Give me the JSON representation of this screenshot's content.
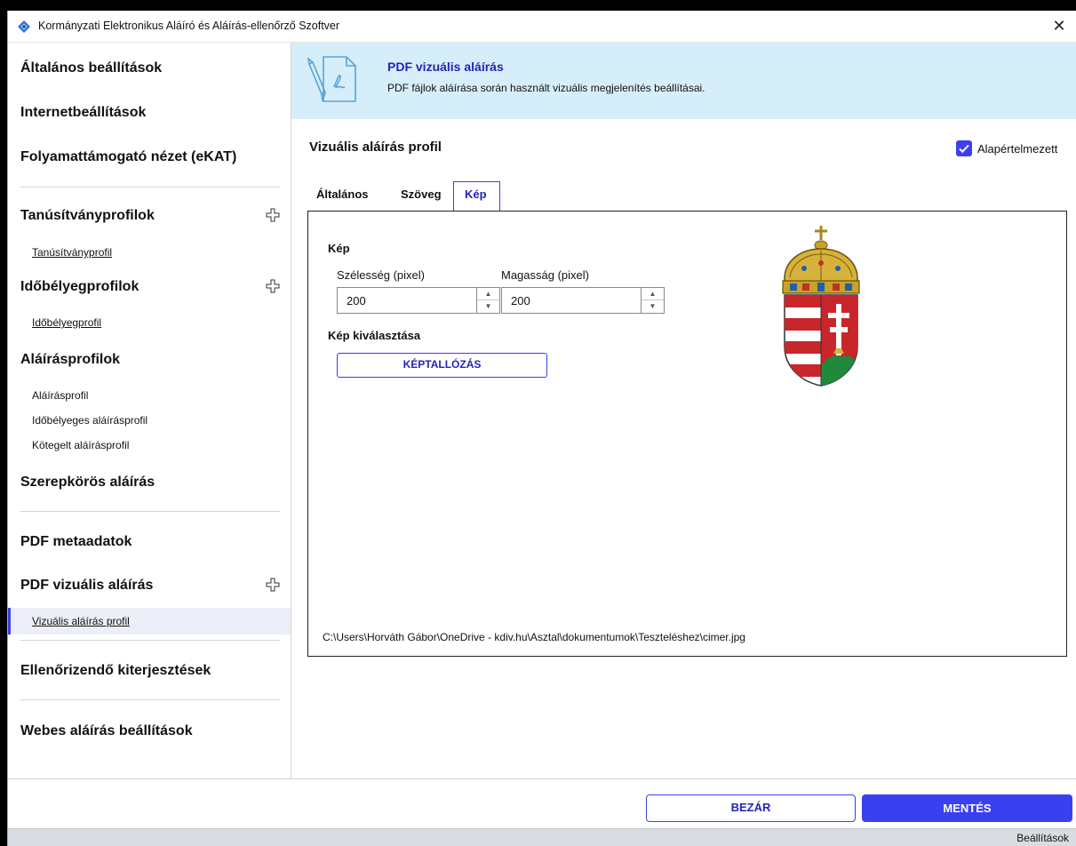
{
  "window": {
    "title": "Kormányzati Elektronikus Aláíró és Aláírás-ellenőrző Szoftver",
    "close_glyph": "✕"
  },
  "sidebar": {
    "general": "Általános beállítások",
    "internet": "Internetbeállítások",
    "ekat": "Folyamattámogató nézet (eKAT)",
    "cert_profiles": "Tanúsítványprofilok",
    "cert_profile_item": "Tanúsítványprofil",
    "ts_profiles": "Időbélyegprofilok",
    "ts_profile_item": "Időbélyegprofil",
    "sig_profiles": "Aláírásprofilok",
    "sig_profile_item": "Aláírásprofil",
    "ts_sig_profile_item": "Időbélyeges aláírásprofil",
    "batch_sig_profile_item": "Kötegelt aláírásprofil",
    "role_signature": "Szerepkörös aláírás",
    "pdf_metadata": "PDF metaadatok",
    "pdf_visual": "PDF vizuális aláírás",
    "pdf_visual_item": "Vizuális aláírás profil",
    "extensions": "Ellenőrizendő kiterjesztések",
    "web_signature": "Webes aláírás beállítások"
  },
  "header": {
    "title": "PDF vizuális aláírás",
    "description": "PDF fájlok aláírása során használt vizuális megjelenítés beállításai."
  },
  "profile": {
    "title": "Vizuális aláírás profil",
    "default_label": "Alapértelmezett",
    "default_checked": true
  },
  "tabs": [
    "Általános",
    "Szöveg",
    "Kép"
  ],
  "active_tab": "Kép",
  "image_panel": {
    "section_title": "Kép",
    "width_label": "Szélesség (pixel)",
    "width_value": "200",
    "height_label": "Magasság (pixel)",
    "height_value": "200",
    "select_title": "Kép kiválasztása",
    "browse_label": "KÉPTALLÓZÁS",
    "file_path": "C:\\Users\\Horváth Gábor\\OneDrive - kdiv.hu\\Asztal\\dokumentumok\\Teszteléshez\\cimer.jpg"
  },
  "footer": {
    "close_label": "BEZÁR",
    "save_label": "MENTÉS"
  },
  "status": {
    "text": "Beállítások"
  },
  "colors": {
    "accent": "#3a3ff0",
    "header_band": "#d6eef9",
    "accent_text": "#2424b8"
  }
}
